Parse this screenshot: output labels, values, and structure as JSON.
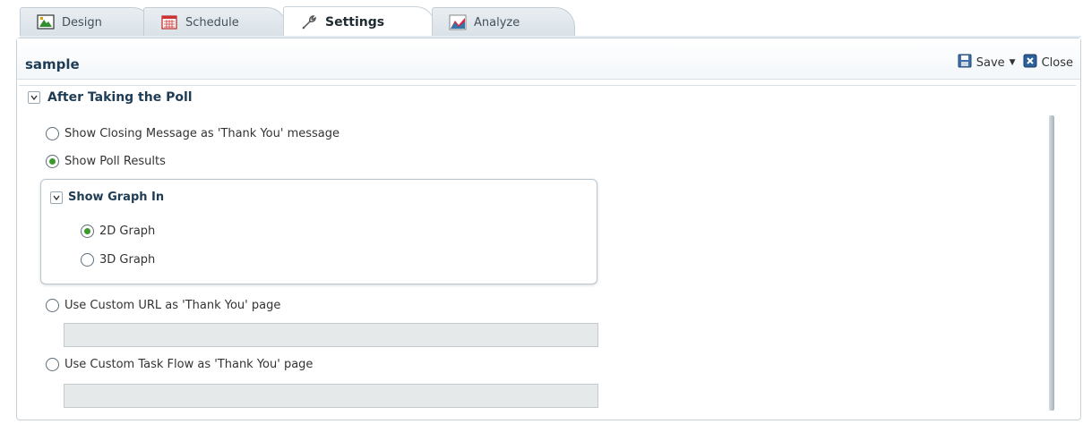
{
  "tabs": [
    {
      "label": "Design",
      "icon": "design-icon",
      "active": false
    },
    {
      "label": "Schedule",
      "icon": "calendar-icon",
      "active": false
    },
    {
      "label": "Settings",
      "icon": "wrench-icon",
      "active": true
    },
    {
      "label": "Analyze",
      "icon": "chart-icon",
      "active": false
    }
  ],
  "page": {
    "title": "sample"
  },
  "toolbar": {
    "save_label": "Save",
    "close_label": "Close"
  },
  "section": {
    "title": "After Taking the Poll",
    "options": {
      "closing_message": "Show Closing Message as 'Thank You' message",
      "poll_results": "Show Poll Results",
      "custom_url": "Use Custom URL as 'Thank You' page",
      "custom_task_flow": "Use Custom Task Flow as 'Thank You' page"
    },
    "selected": "poll_results",
    "graph": {
      "title": "Show Graph In",
      "options": {
        "two_d": "2D Graph",
        "three_d": "3D Graph"
      },
      "selected": "two_d"
    },
    "custom_url_value": "",
    "custom_task_flow_value": ""
  },
  "colors": {
    "accent": "#3c9a2a",
    "title": "#1f3c55",
    "border": "#c5d0d8"
  }
}
